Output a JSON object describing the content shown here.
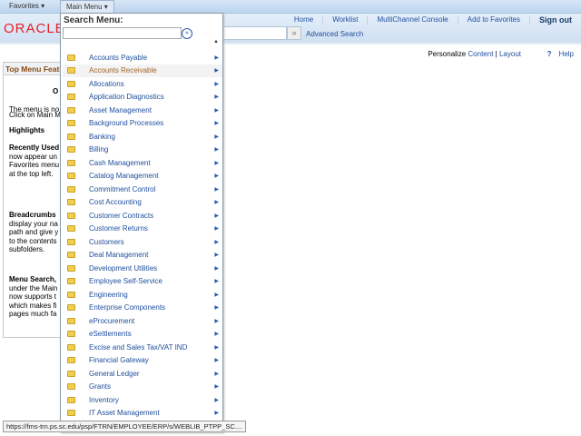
{
  "topbar": {
    "favorites": "Favorites ▾",
    "main_menu": "Main Menu ▾"
  },
  "header": {
    "logo": "ORACLE",
    "links": [
      "Home",
      "Worklist",
      "MultiChannel Console",
      "Add to Favorites",
      "Sign out"
    ],
    "search_go": "»",
    "advanced_search": "Advanced Search"
  },
  "page": {
    "personalize": "Personalize",
    "content": "Content",
    "sep": "|",
    "layout": "Layout",
    "help_icon": "?",
    "help": "Help"
  },
  "panel": {
    "title": "Top Menu Features",
    "lines": [
      "O",
      "The menu is no",
      "Click on Main M",
      "Highlights",
      "Recently Used",
      "now appear un",
      "Favorites menu",
      "at the top left.",
      "Breadcrumbs",
      "display your na",
      "path and give y",
      "to the contents",
      "subfolders.",
      "Menu Search,",
      "under the Main",
      "now supports t",
      "which makes fi",
      "pages much fa"
    ]
  },
  "menu": {
    "title": "Search Menu:",
    "search_value": "",
    "go": "»",
    "scroll_up": "▲",
    "items": [
      "Accounts Payable",
      "Accounts Receivable",
      "Allocations",
      "Application Diagnostics",
      "Asset Management",
      "Background Processes",
      "Banking",
      "Billing",
      "Cash Management",
      "Catalog Management",
      "Commitment Control",
      "Cost Accounting",
      "Customer Contracts",
      "Customer Returns",
      "Customers",
      "Deal Management",
      "Development Utilities",
      "Employee Self-Service",
      "Engineering",
      "Enterprise Components",
      "eProcurement",
      "eSettlements",
      "Excise and Sales Tax/VAT IND",
      "Financial Gateway",
      "General Ledger",
      "Grants",
      "Inventory",
      "IT Asset Management"
    ],
    "highlighted": "Accounts Receivable"
  },
  "status_url": "https://fms-trn.ps.sc.edu/psp/FTRN/EMPLOYEE/ERP/s/WEBLIB_PTPP_SC...."
}
